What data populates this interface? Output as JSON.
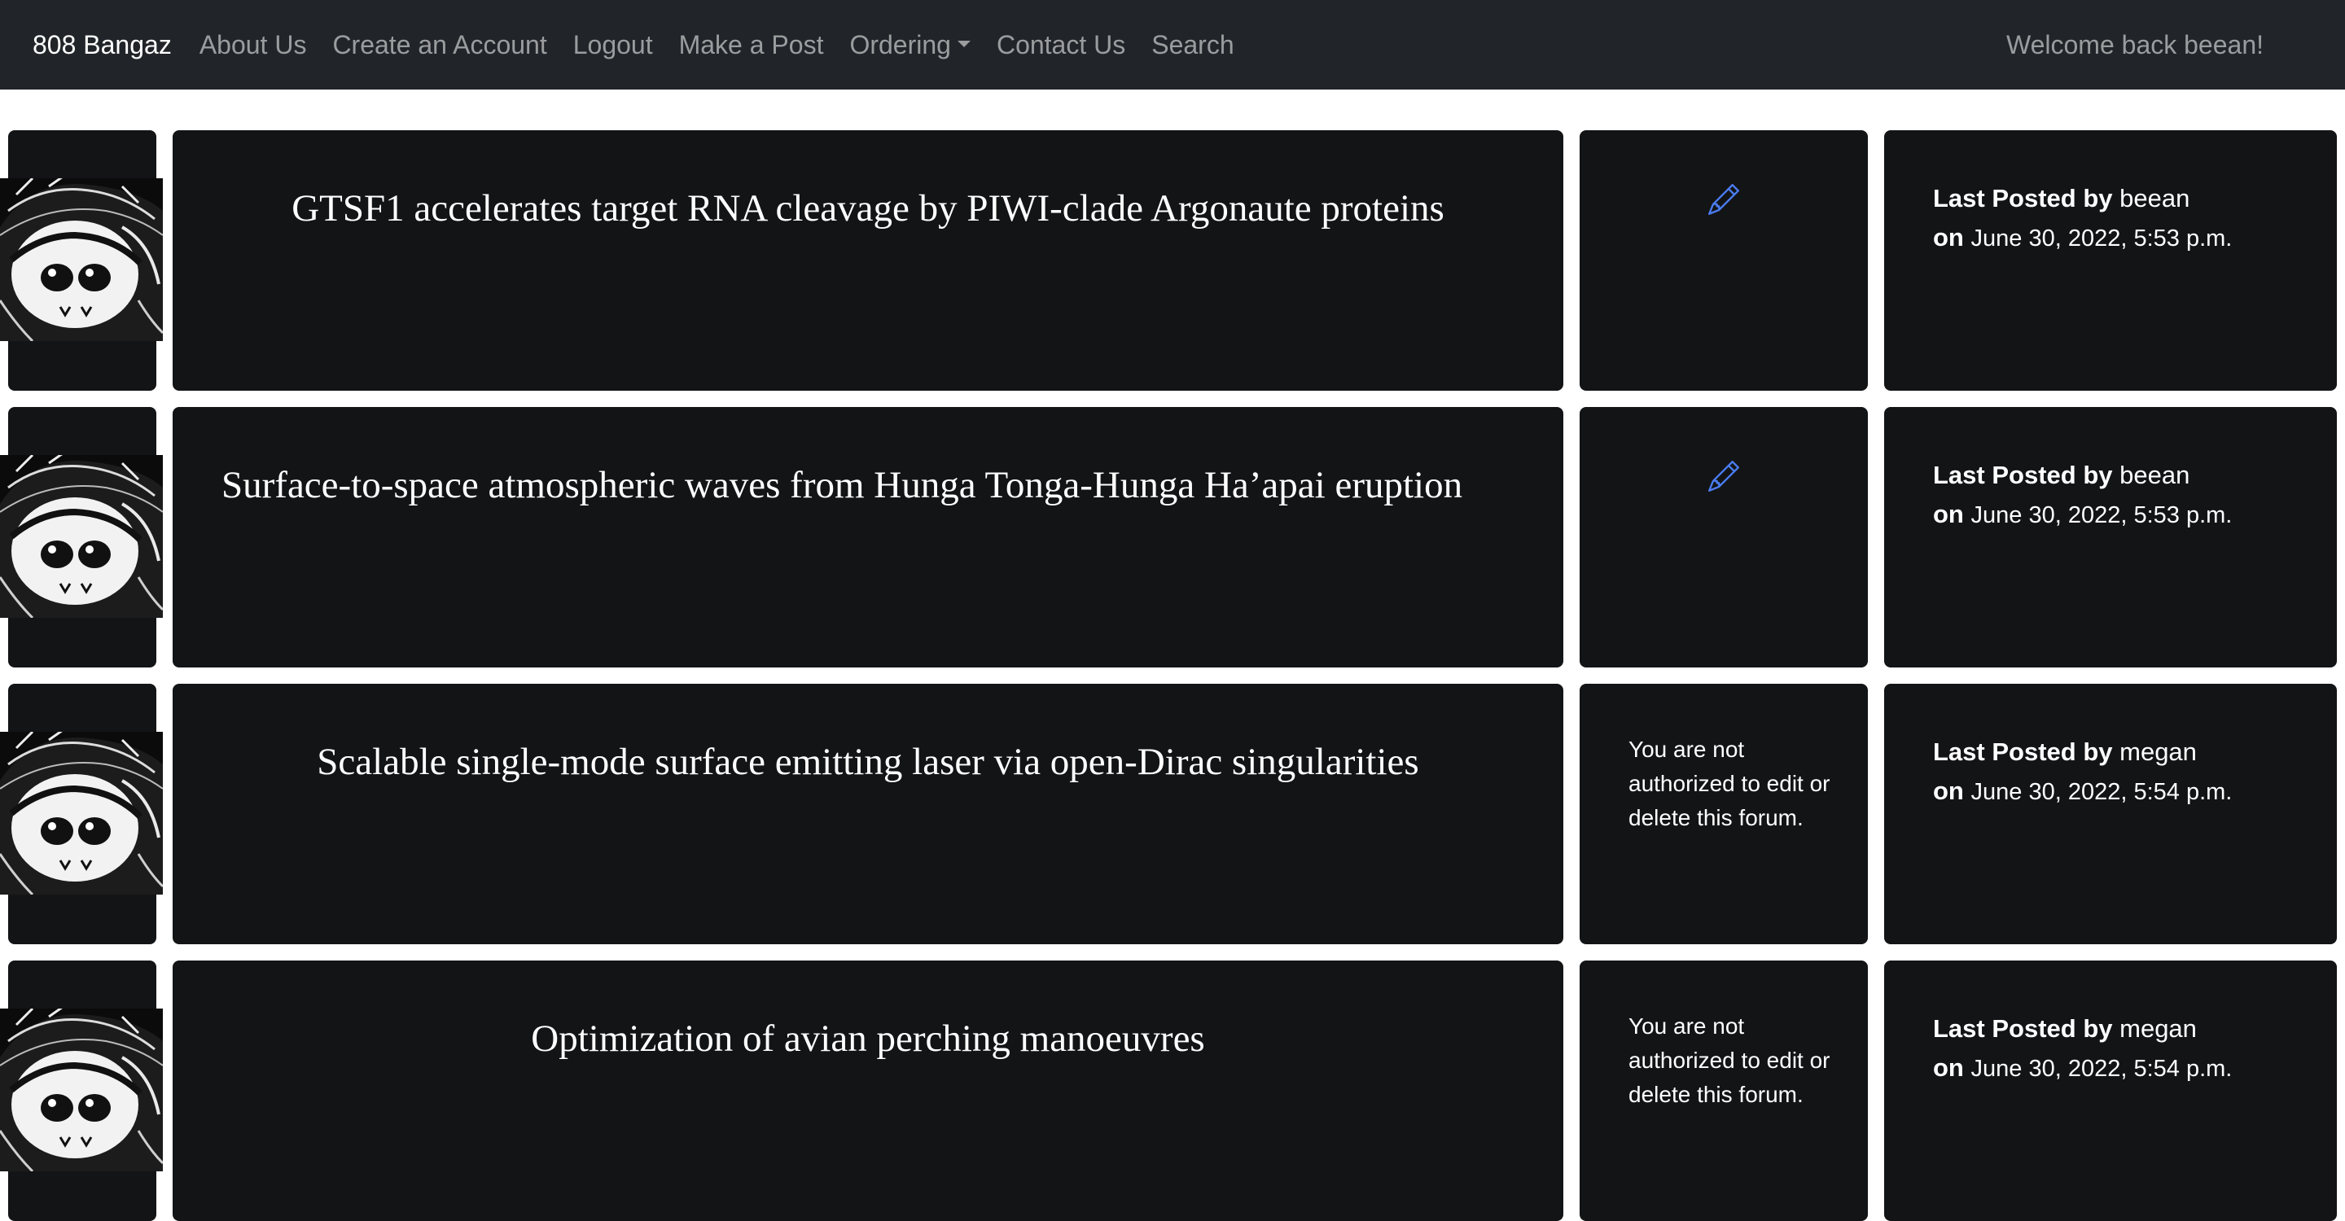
{
  "navbar": {
    "brand": "808 Bangaz",
    "links": [
      "About Us",
      "Create an Account",
      "Logout",
      "Make a Post",
      "Ordering",
      "Contact Us",
      "Search"
    ],
    "welcome": "Welcome back beean!"
  },
  "labels": {
    "last_posted_by": "Last Posted by",
    "on": "on"
  },
  "posts": [
    {
      "title": "GTSF1 accelerates target RNA cleavage by PIWI-clade Argonaute proteins",
      "author": "beean",
      "date": "June 30, 2022, 5:53 p.m.",
      "action_text": ""
    },
    {
      "title": "Surface-to-space atmospheric waves from Hunga Tonga-Hunga Ha’apai eruption",
      "author": "beean",
      "date": "June 30, 2022, 5:53 p.m.",
      "action_text": ""
    },
    {
      "title": "Scalable single-mode surface emitting laser via open-Dirac singularities",
      "author": "megan",
      "date": "June 30, 2022, 5:54 p.m.",
      "action_text": "You are not authorized to edit or delete this forum."
    },
    {
      "title": "Optimization of avian perching manoeuvres",
      "author": "megan",
      "date": "June 30, 2022, 5:54 p.m.",
      "action_text": "You are not authorized to edit or delete this forum."
    }
  ],
  "colors": {
    "navbar_bg": "#212529",
    "card_bg": "#131416",
    "edit_icon": "#4a7cf0"
  }
}
